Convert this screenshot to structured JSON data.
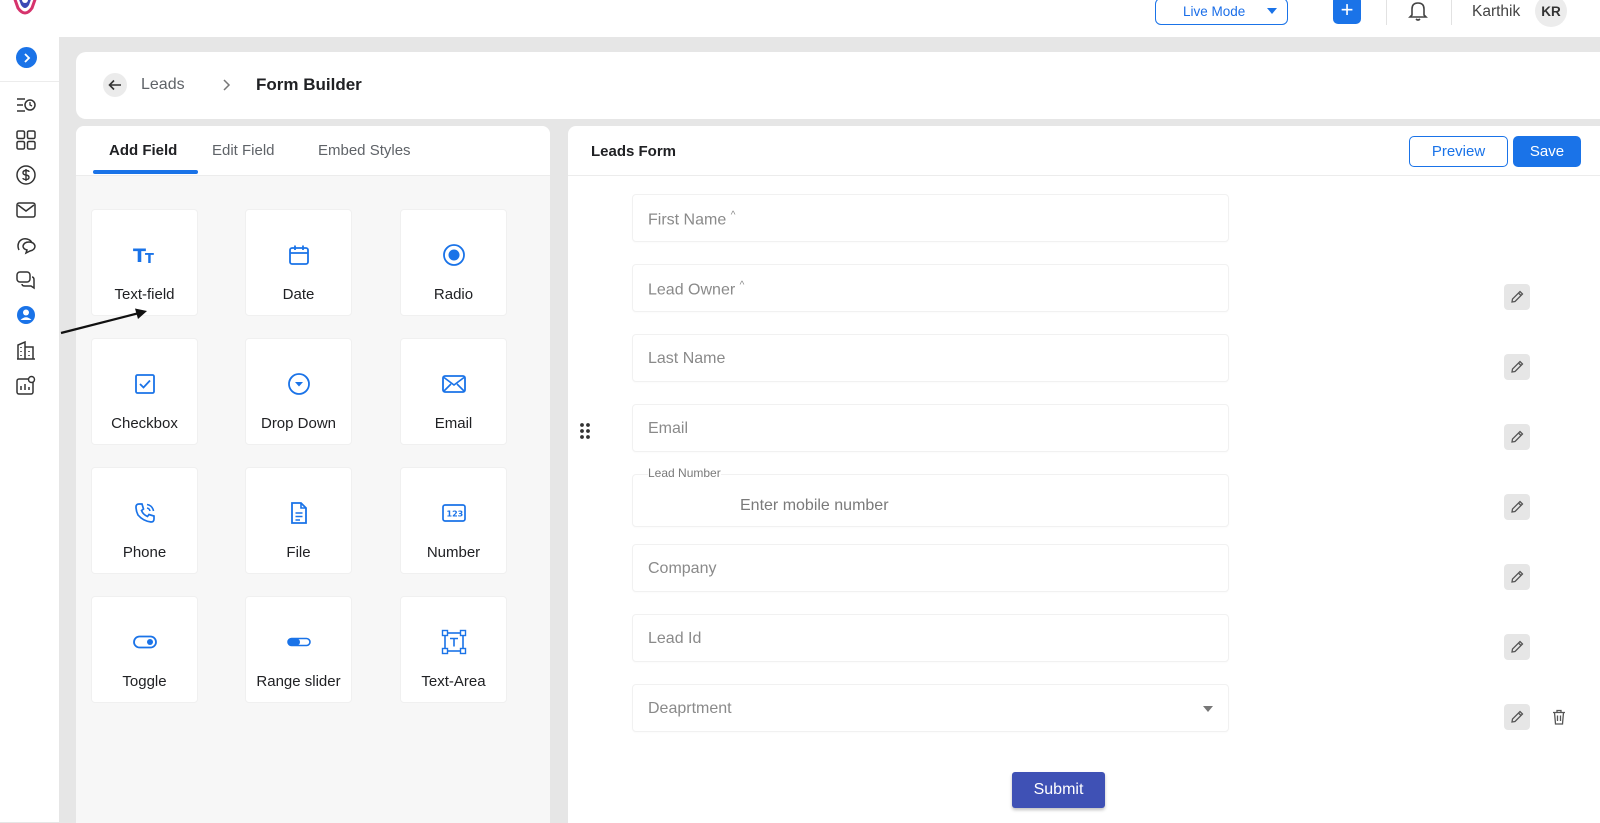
{
  "topbar": {
    "mode_label": "Live Mode",
    "add_label": "+",
    "user_name": "Karthik",
    "user_initials": "KR"
  },
  "sidebar": {
    "items": [
      {
        "name": "activity-icon"
      },
      {
        "name": "grid-icon"
      },
      {
        "name": "dollar-icon"
      },
      {
        "name": "mail-icon"
      },
      {
        "name": "chats-icon"
      },
      {
        "name": "messages-icon"
      },
      {
        "name": "user-icon",
        "active": true
      },
      {
        "name": "building-icon"
      },
      {
        "name": "analytics-settings-icon"
      }
    ]
  },
  "breadcrumb": {
    "parent": "Leads",
    "current": "Form Builder"
  },
  "palette": {
    "tabs": [
      {
        "label": "Add Field",
        "active": true
      },
      {
        "label": "Edit Field",
        "active": false
      },
      {
        "label": "Embed Styles",
        "active": false
      }
    ],
    "tiles": [
      {
        "label": "Text-field",
        "icon": "text-icon"
      },
      {
        "label": "Date",
        "icon": "calendar-icon"
      },
      {
        "label": "Radio",
        "icon": "radio-icon"
      },
      {
        "label": "Checkbox",
        "icon": "checkbox-icon"
      },
      {
        "label": "Drop Down",
        "icon": "dropdown-icon"
      },
      {
        "label": "Email",
        "icon": "email-icon"
      },
      {
        "label": "Phone",
        "icon": "phone-icon"
      },
      {
        "label": "File",
        "icon": "file-icon"
      },
      {
        "label": "Number",
        "icon": "number-icon"
      },
      {
        "label": "Toggle",
        "icon": "toggle-icon"
      },
      {
        "label": "Range slider",
        "icon": "range-slider-icon"
      },
      {
        "label": "Text-Area",
        "icon": "text-area-icon"
      }
    ]
  },
  "form": {
    "title": "Leads Form",
    "preview_label": "Preview",
    "save_label": "Save",
    "fields": [
      {
        "placeholder": "First Name",
        "mark": "^"
      },
      {
        "placeholder": "Lead Owner",
        "mark": "^"
      },
      {
        "placeholder": "Last Name"
      },
      {
        "placeholder": "Email"
      },
      {
        "label": "Lead Number",
        "placeholder": "Enter mobile number"
      },
      {
        "placeholder": "Company"
      },
      {
        "placeholder": "Lead Id"
      },
      {
        "placeholder": "Deaprtment",
        "type": "select"
      }
    ],
    "submit_label": "Submit"
  },
  "colors": {
    "accent": "#1a73e8",
    "submit": "#3f51b5",
    "background": "#e6e6e6"
  }
}
